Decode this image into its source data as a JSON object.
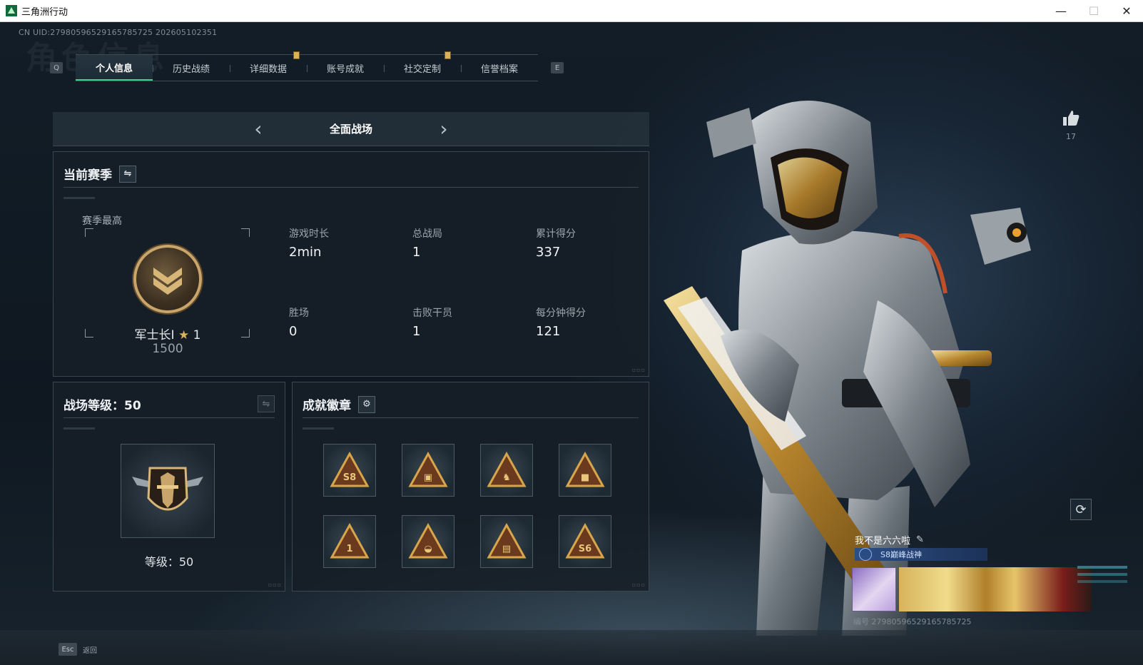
{
  "window": {
    "title": "三角洲行动",
    "controls": {
      "minimize": "—",
      "maximize": "☐",
      "close": "✕"
    }
  },
  "uid": "CN UID:27980596529165785725 202605102351",
  "watermark": "角色信息",
  "tabs": {
    "prev_key": "Q",
    "next_key": "E",
    "items": [
      {
        "label": "个人信息",
        "active": true
      },
      {
        "label": "历史战绩",
        "active": false
      },
      {
        "label": "详细数据",
        "active": false
      },
      {
        "label": "账号成就",
        "active": false
      },
      {
        "label": "社交定制",
        "active": false
      },
      {
        "label": "信誉档案",
        "active": false
      }
    ]
  },
  "mode": {
    "label": "全面战场",
    "prev": "‹",
    "next": "›"
  },
  "season": {
    "title": "当前赛季",
    "swap_icon": "⇋",
    "best_label": "赛季最高",
    "rank_name": "军士长Ⅰ",
    "star_icon": "★",
    "stars": "1",
    "rank_score": "1500",
    "stats": [
      {
        "label": "游戏时长",
        "value": "2min"
      },
      {
        "label": "总战局",
        "value": "1"
      },
      {
        "label": "累计得分",
        "value": "337"
      },
      {
        "label": "胜场",
        "value": "0"
      },
      {
        "label": "击败干员",
        "value": "1"
      },
      {
        "label": "每分钟得分",
        "value": "121"
      }
    ]
  },
  "level_panel": {
    "title": "战场等级：50",
    "swap_icon": "⇋",
    "level_text": "等级：50"
  },
  "badges": {
    "title": "成就徽章",
    "gear_icon": "⚙",
    "items": [
      {
        "icon": "s8-badge-icon",
        "glyph": "S8"
      },
      {
        "icon": "crate-badge-icon",
        "glyph": "▣"
      },
      {
        "icon": "soldiers-badge-icon",
        "glyph": "♞"
      },
      {
        "icon": "box-badge-icon",
        "glyph": "■"
      },
      {
        "icon": "number-one-badge-icon",
        "glyph": "1"
      },
      {
        "icon": "bowl-badge-icon",
        "glyph": "◒"
      },
      {
        "icon": "rocket-badge-icon",
        "glyph": "▤"
      },
      {
        "icon": "s6-badge-icon",
        "glyph": "S6"
      }
    ]
  },
  "like": {
    "icon": "👍",
    "count": "17"
  },
  "refresh_icon": "⟳",
  "namecard": {
    "name": "我不是六六啦",
    "edit_icon": "✎",
    "title": "S8巅峰战神",
    "id": "编号 27980596529165785725"
  },
  "bottom": {
    "esc_key": "Esc",
    "esc_label": "返回"
  },
  "colors": {
    "accent_green": "#3fd48b",
    "gold": "#d9b25a",
    "bg": "#0d151c"
  }
}
